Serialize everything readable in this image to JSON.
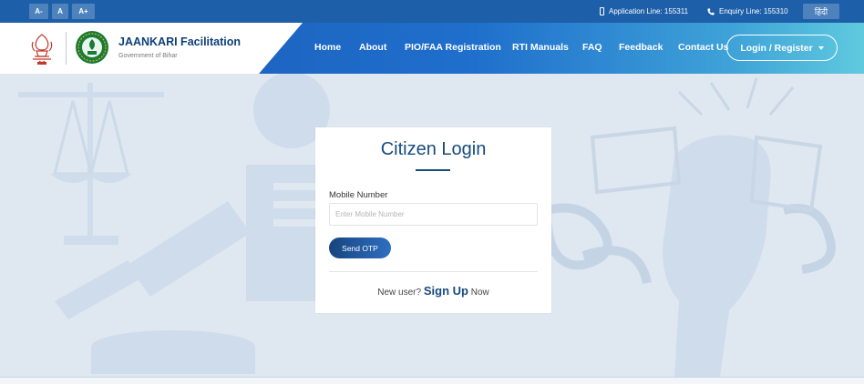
{
  "topbar": {
    "font_controls": [
      "A-",
      "A",
      "A+"
    ],
    "application_line": "Application Line: 155311",
    "enquiry_line": "Enquiry Line: 155310",
    "language": "हिंदी"
  },
  "brand": {
    "title": "JAANKARI Facilitation",
    "subtitle": "Government of Bihar",
    "emblem_icon": "state-emblem-icon",
    "seal_icon": "bihar-seal-icon"
  },
  "nav": {
    "items": [
      "Home",
      "About",
      "PIO/FAA Registration",
      "RTI Manuals",
      "FAQ",
      "Feedback",
      "Contact Us"
    ],
    "login_label": "Login / Register"
  },
  "login_card": {
    "title": "Citizen Login",
    "mobile_label": "Mobile Number",
    "mobile_placeholder": "Enter Mobile Number",
    "mobile_value": "",
    "send_otp_label": "Send OTP",
    "new_user_text": "New user?",
    "signup_label": "Sign Up",
    "now_text": "Now"
  },
  "colors": {
    "topbar": "#1d5fa8",
    "nav_gradient_start": "#1c58b8",
    "nav_gradient_end": "#5fcadf",
    "accent": "#174b7e",
    "page_bg": "#dfe8f1"
  }
}
